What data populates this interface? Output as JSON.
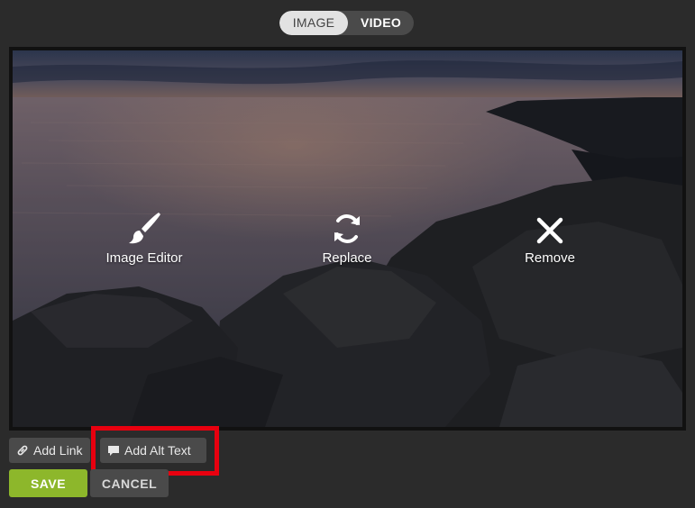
{
  "media_toggle": {
    "image_label": "IMAGE",
    "video_label": "VIDEO",
    "selected": "IMAGE"
  },
  "image_actions": {
    "editor_label": "Image Editor",
    "replace_label": "Replace",
    "remove_label": "Remove"
  },
  "icons": {
    "editor": "paintbrush-icon",
    "replace": "refresh-icon",
    "remove": "close-icon",
    "link": "link-icon",
    "alt_text": "speech-bubble-icon"
  },
  "image_options": {
    "add_link_label": "Add Link",
    "add_alt_text_label": "Add Alt Text"
  },
  "form_actions": {
    "save_label": "SAVE",
    "cancel_label": "CANCEL"
  },
  "colors": {
    "save": "#8db72b",
    "highlight": "#e8000f",
    "background": "#2b2b2b"
  }
}
